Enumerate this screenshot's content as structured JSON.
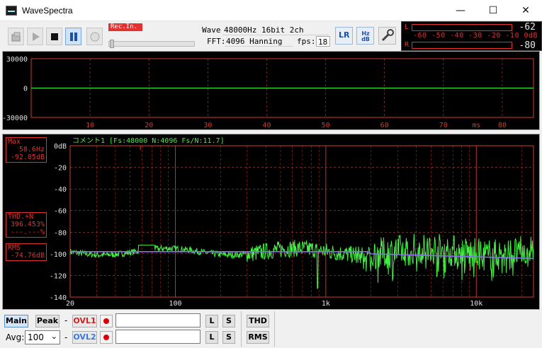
{
  "window": {
    "title": "WaveSpectra",
    "minimize_glyph": "—",
    "maximize_glyph": "☐",
    "close_glyph": "✕"
  },
  "toolbar": {
    "rec_in_label": "Rec.In.",
    "wave_label": "Wave:",
    "wave_value": "48000Hz 16bit 2ch",
    "fft_label": "FFT:",
    "fft_value": "4096 Hanning",
    "fps_label": "fps:",
    "fps_value": "18",
    "lr_button_label": "LR",
    "hz_db_button_label": "Hz dB"
  },
  "level_meter": {
    "left_channel": "L",
    "right_channel": "R",
    "scale": "-60 -50 -40 -30 -20 -10 0dB",
    "left_value": "-62",
    "right_value": "-80"
  },
  "waveform": {
    "y_ticks": [
      "30000",
      "0",
      "-30000"
    ],
    "x_ticks": [
      "10",
      "20",
      "30",
      "40",
      "50",
      "60",
      "70",
      "80"
    ],
    "x_unit": "ms"
  },
  "spectrum": {
    "comment": "コメント1  [Fs:48000 N:4096 Fs/N:11.7]",
    "y_ticks": [
      "0dB",
      "-20",
      "-40",
      "-60",
      "-80",
      "-100",
      "-120",
      "-140"
    ],
    "x_ticks": [
      "20",
      "100",
      "1k",
      "10k"
    ],
    "max_box": {
      "title": "Max",
      "freq": "58.6Hz",
      "level": "-92.05dB"
    },
    "thd_box": {
      "title": "THD.+N",
      "value1": "396.453%",
      "value2": "---.---%"
    },
    "rms_box": {
      "title": "RMS",
      "value": "-74.76dB"
    }
  },
  "bottom": {
    "main_label": "Main",
    "peak_label": "Peak",
    "dash": "-",
    "ovl1_label": "OVL1",
    "ovl2_label": "OVL2",
    "l_label": "L",
    "s_label": "S",
    "thd_label": "THD",
    "rms_label": "RMS",
    "avg_label": "Avg:",
    "avg_value": "100",
    "avg_options": [
      "100"
    ]
  },
  "colors": {
    "grid": "#d23a2a",
    "wave_line": "#33dd33",
    "spectrum_line": "#44ee44",
    "average_line": "#8a6cf0",
    "ovl1_text": "#d02020",
    "ovl2_text": "#3a78d8"
  }
}
